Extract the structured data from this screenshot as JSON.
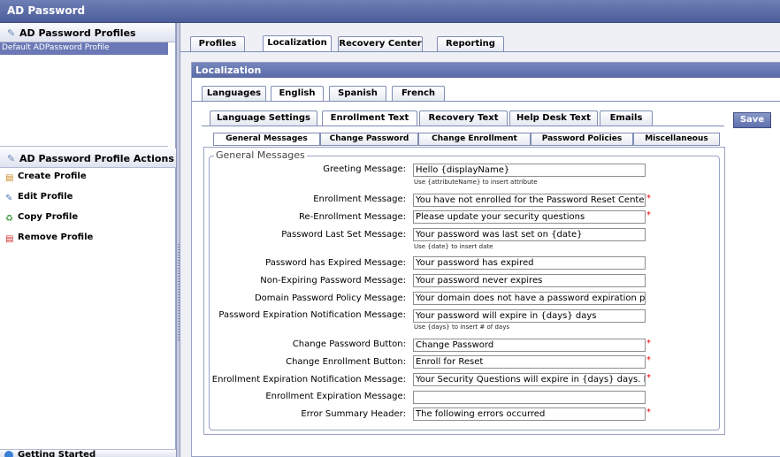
{
  "window": {
    "title": "AD Password"
  },
  "left": {
    "profiles_header": "AD Password Profiles",
    "profiles": [
      "Default ADPassword Profile"
    ],
    "actions_header": "AD Password Profile Actions",
    "actions": [
      {
        "label": "Create Profile",
        "icon": "create-icon"
      },
      {
        "label": "Edit Profile",
        "icon": "edit-icon"
      },
      {
        "label": "Copy Profile",
        "icon": "copy-icon"
      },
      {
        "label": "Remove Profile",
        "icon": "remove-icon"
      }
    ],
    "bottom_section": "Getting Started"
  },
  "main_tabs": [
    "Profiles",
    "Localization",
    "Recovery Center",
    "Reporting"
  ],
  "panel_title": "Localization",
  "language_tabs": [
    "Languages",
    "English",
    "Spanish",
    "French"
  ],
  "section_tabs": [
    "Language Settings",
    "Enrollment Text",
    "Recovery Text",
    "Help Desk Text",
    "Emails"
  ],
  "save_label": "Save",
  "message_tabs": [
    "General Messages",
    "Change Password",
    "Change Enrollment",
    "Password Policies",
    "Miscellaneous"
  ],
  "group_title": "General Messages",
  "fields": [
    {
      "label": "Greeting Message:",
      "value": "Hello {displayName}",
      "hint": "Use {attributeName} to insert attribute",
      "required": false
    },
    {
      "label": "Enrollment Message:",
      "value": "You have not enrolled for the Password Reset Center",
      "hint": "",
      "required": true
    },
    {
      "label": "Re-Enrollment Message:",
      "value": "Please update your security questions",
      "hint": "",
      "required": true
    },
    {
      "label": "Password Last Set Message:",
      "value": "Your password was last set on {date}",
      "hint": "Use {date} to insert date",
      "required": false
    },
    {
      "label": "Password has Expired Message:",
      "value": "Your password has expired",
      "hint": "",
      "required": false
    },
    {
      "label": "Non-Expiring Password Message:",
      "value": "Your password never expires",
      "hint": "",
      "required": false
    },
    {
      "label": "Domain Password Policy Message:",
      "value": "Your domain does not have a password expiration policy",
      "hint": "",
      "required": false
    },
    {
      "label": "Password Expiration Notification Message:",
      "value": "Your password will expire in {days} days",
      "hint": "Use {days} to insert # of days",
      "required": false
    },
    {
      "label": "Change Password Button:",
      "value": "Change Password",
      "hint": "",
      "required": true
    },
    {
      "label": "Change Enrollment Button:",
      "value": "Enroll for Reset",
      "hint": "",
      "required": true
    },
    {
      "label": "Enrollment Expiration Notification Message:",
      "value": "Your Security Questions will expire in {days} days. Please",
      "hint": "",
      "required": true
    },
    {
      "label": "Enrollment Expiration Message:",
      "value": "",
      "hint": "",
      "required": false
    },
    {
      "label": "Error Summary Header:",
      "value": "The following errors occurred",
      "hint": "",
      "required": true
    }
  ],
  "required_mark": "*",
  "colors": {
    "accent": "#5a6aa6",
    "selection": "#6a78b5",
    "required": "#e00000"
  }
}
